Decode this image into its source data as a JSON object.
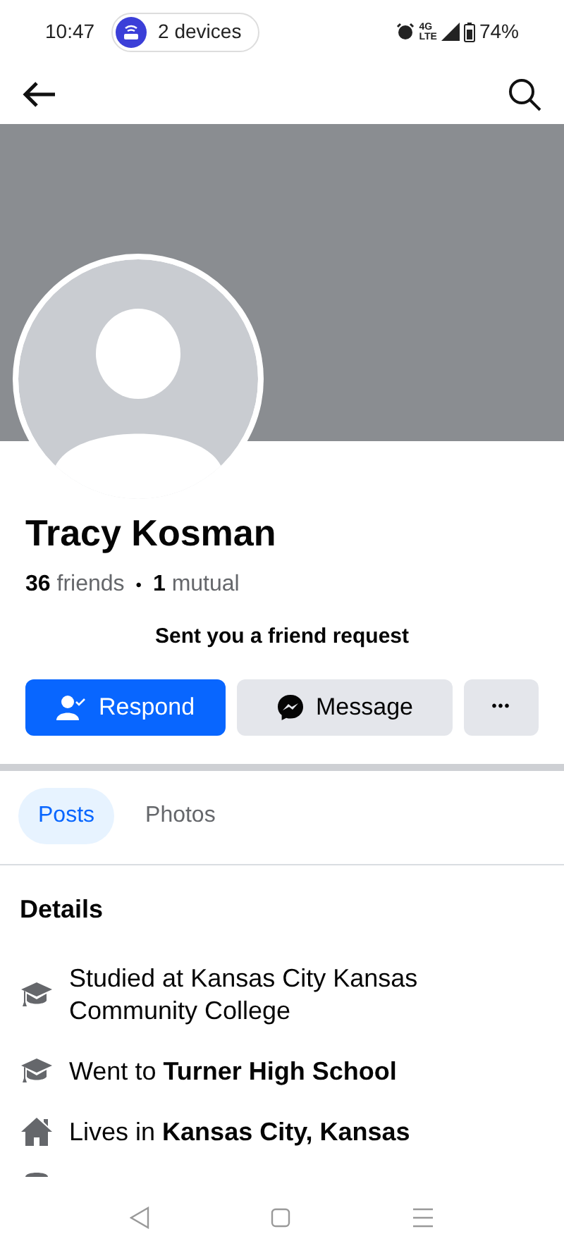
{
  "status_bar": {
    "time": "10:47",
    "hotspot": "2 devices",
    "network": "4G",
    "network_sub": "LTE",
    "battery": "74%"
  },
  "profile": {
    "name": "Tracy Kosman",
    "friends": "**36** friends",
    "separator": "•",
    "mutual": "**1** mutual",
    "request_note": "Sent you a friend request"
  },
  "buttons": [
    {
      "kind": "respond",
      "label": "Respond"
    },
    {
      "kind": "message",
      "label": "Message"
    },
    {
      "kind": "more",
      "label": "•••"
    }
  ],
  "tabs": [
    {
      "label": "Posts",
      "selected": true
    },
    {
      "label": "Photos",
      "selected": false
    }
  ],
  "details": {
    "title": "Details",
    "items": [
      {
        "kind": "school",
        "text": "Studied at Kansas City Kansas Community College"
      },
      {
        "kind": "school",
        "text": "Went to **Turner High School**"
      },
      {
        "kind": "home",
        "text": "Lives in **Kansas City, Kansas**"
      }
    ]
  }
}
